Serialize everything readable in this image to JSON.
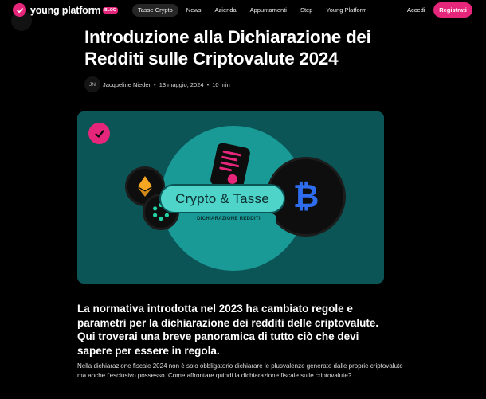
{
  "nav": {
    "logo_text": "young platform",
    "logo_badge": "BLOG",
    "links": [
      "Tasse Crypto",
      "News",
      "Azienda",
      "Appuntamenti",
      "Step",
      "Young Platform"
    ],
    "login_label": "Accedi",
    "register_label": "Registrati"
  },
  "article": {
    "title": "Introduzione alla Dichiarazione dei Redditi sulle Criptovalute 2024",
    "author_initials": "JN",
    "author": "Jacqueline Nieder",
    "date": "13 maggio, 2024",
    "read_time": "10 min",
    "hero": {
      "pill_text": "Crypto & Tasse",
      "subtitle": "DICHIARAZIONE REDDITI",
      "coin_btc_symbol": "₿"
    },
    "lead": "La normativa introdotta nel 2023 ha cambiato regole e parametri per la dichiarazione dei redditi delle criptovalute. Qui troverai una breve panoramica di tutto ciò che devi sapere per essere in regola.",
    "body": "Nella dichiarazione fiscale 2024 non è solo obbligatorio dichiarare le plusvalenze generate dalle proprie criptovalute ma anche l'esclusivo possesso. Come affrontare quindi la dichiarazione fiscale sulle criptovalute?"
  },
  "colors": {
    "brand": "#e6267a",
    "hero_bg": "#0b5557",
    "hero_circle": "#1a9a96",
    "pill": "#4ed4c9"
  }
}
